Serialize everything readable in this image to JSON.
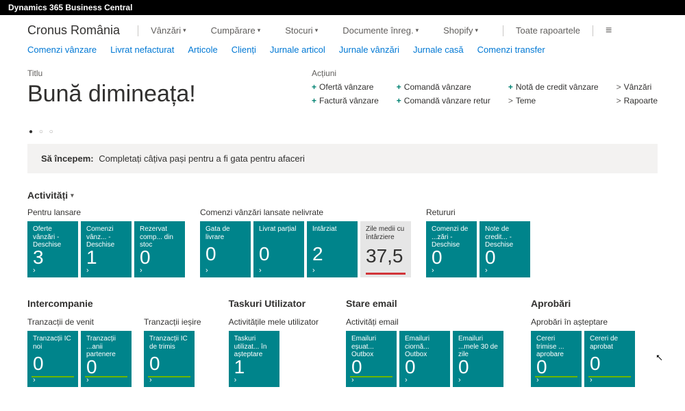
{
  "app_title": "Dynamics 365 Business Central",
  "company": "Cronus România",
  "main_nav": [
    "Vânzări",
    "Cumpărare",
    "Stocuri",
    "Documente înreg.",
    "Shopify"
  ],
  "all_reports": "Toate rapoartele",
  "quick_links": [
    "Comenzi vânzare",
    "Livrat nefacturat",
    "Articole",
    "Clienți",
    "Jurnale articol",
    "Jurnale vânzări",
    "Jurnale casă",
    "Comenzi transfer"
  ],
  "title_label": "Titlu",
  "greeting": "Bună dimineața!",
  "actions_label": "Acțiuni",
  "actions": [
    {
      "sym": "+",
      "text": "Ofertă vânzare"
    },
    {
      "sym": "+",
      "text": "Comandă vânzare"
    },
    {
      "sym": "+",
      "text": "Notă de credit vânzare"
    },
    {
      "sym": ">",
      "text": "Vânzări",
      "gray": true
    },
    {
      "sym": "+",
      "text": "Factură vânzare"
    },
    {
      "sym": "+",
      "text": "Comandă vânzare retur"
    },
    {
      "sym": ">",
      "text": "Teme",
      "gray": true
    },
    {
      "sym": ">",
      "text": "Rapoarte",
      "gray": true
    }
  ],
  "banner_lead": "Să începem:",
  "banner_text": "Completați câțiva pași pentru a fi gata pentru afaceri",
  "activities_heading": "Activități",
  "row1": [
    {
      "title": "Pentru lansare",
      "tiles": [
        {
          "label": "Oferte vânzări - Deschise",
          "value": "3"
        },
        {
          "label": "Comenzi vânz... - Deschise",
          "value": "1"
        },
        {
          "label": "Rezervat comp... din stoc",
          "value": "0"
        }
      ]
    },
    {
      "title": "Comenzi vânzări lansate nelivrate",
      "tiles": [
        {
          "label": "Gata de livrare",
          "value": "0"
        },
        {
          "label": "Livrat parțial",
          "value": "0"
        },
        {
          "label": "Întârziat",
          "value": "2"
        },
        {
          "label": "Zile medii cu întârziere",
          "value": "37,5",
          "gray": true
        }
      ]
    },
    {
      "title": "Retururi",
      "tiles": [
        {
          "label": "Comenzi de ...zări - Deschise",
          "value": "0"
        },
        {
          "label": "Note de credit... - Deschise",
          "value": "0"
        }
      ]
    }
  ],
  "row2": [
    {
      "heading": "Intercompanie",
      "subs": [
        {
          "title": "Tranzacții de venit",
          "tiles": [
            {
              "label": "Tranzacții IC noi",
              "value": "0",
              "green": true
            },
            {
              "label": "Tranzacții ...anii partenere",
              "value": "0",
              "green": true
            }
          ]
        },
        {
          "title": "Tranzacții ieșire",
          "tiles": [
            {
              "label": "Tranzacții IC de trimis",
              "value": "0",
              "green": true
            }
          ]
        }
      ]
    },
    {
      "heading": "Taskuri Utilizator",
      "subs": [
        {
          "title": "Activitățile mele utilizator",
          "tiles": [
            {
              "label": "Taskuri utilizat... în așteptare",
              "value": "1"
            }
          ]
        }
      ]
    },
    {
      "heading": "Stare email",
      "subs": [
        {
          "title": "Activități email",
          "tiles": [
            {
              "label": "Emailuri eșuat... Outbox",
              "value": "0",
              "green": true
            },
            {
              "label": "Emailuri ciornă... Outbox",
              "value": "0"
            },
            {
              "label": "Emailuri ...mele 30 de zile",
              "value": "0"
            }
          ]
        }
      ]
    },
    {
      "heading": "Aprobări",
      "subs": [
        {
          "title": "Aprobări în așteptare",
          "tiles": [
            {
              "label": "Cereri trimise ... aprobare",
              "value": "0",
              "green": true
            },
            {
              "label": "Cereri de aprobat",
              "value": "0",
              "green": true
            }
          ]
        }
      ]
    }
  ]
}
